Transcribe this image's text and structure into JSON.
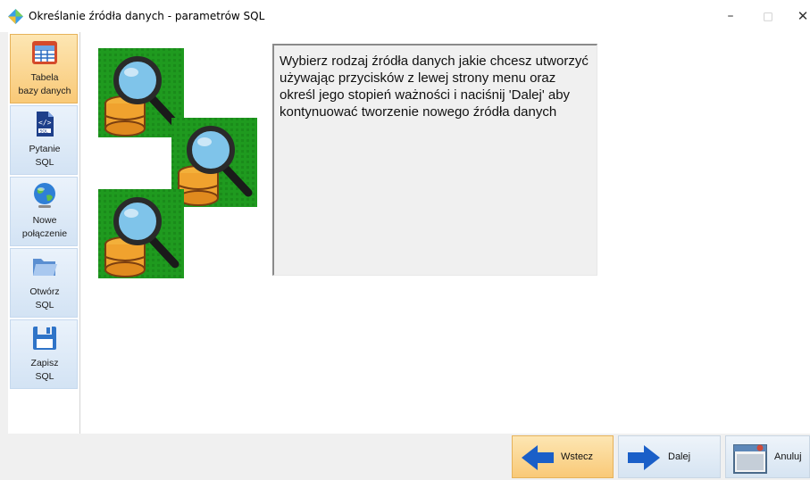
{
  "window": {
    "title": "Określanie źródła danych - parametrów SQL",
    "minimize_glyph": "–",
    "maximize_glyph": "□",
    "close_glyph": "✕"
  },
  "sidebar": {
    "items": [
      {
        "label": "Tabela\nbazy danych",
        "icon": "table-icon",
        "active": true
      },
      {
        "label": "Pytanie\nSQL",
        "icon": "sql-file-icon",
        "active": false
      },
      {
        "label": "Nowe\npołączenie",
        "icon": "globe-icon",
        "active": false
      },
      {
        "label": "Otwórz\nSQL",
        "icon": "folder-open-icon",
        "active": false
      },
      {
        "label": "Zapisz\nSQL",
        "icon": "floppy-disk-icon",
        "active": false
      }
    ]
  },
  "main": {
    "description": "Wybierz rodzaj źródła danych jakie chcesz utworzyć używając przycisków z lewej strony menu oraz określ jego stopień ważności i naciśnij 'Dalej' aby kontynuować tworzenie nowego źródła danych"
  },
  "buttons": {
    "back": "Wstecz",
    "next": "Dalej",
    "cancel": "Anuluj"
  },
  "colors": {
    "accent_active": "#f9c977",
    "button_bg": "#d6e4f2",
    "arrow_blue": "#1a5fc8",
    "hero_green": "#1f9a1f"
  }
}
